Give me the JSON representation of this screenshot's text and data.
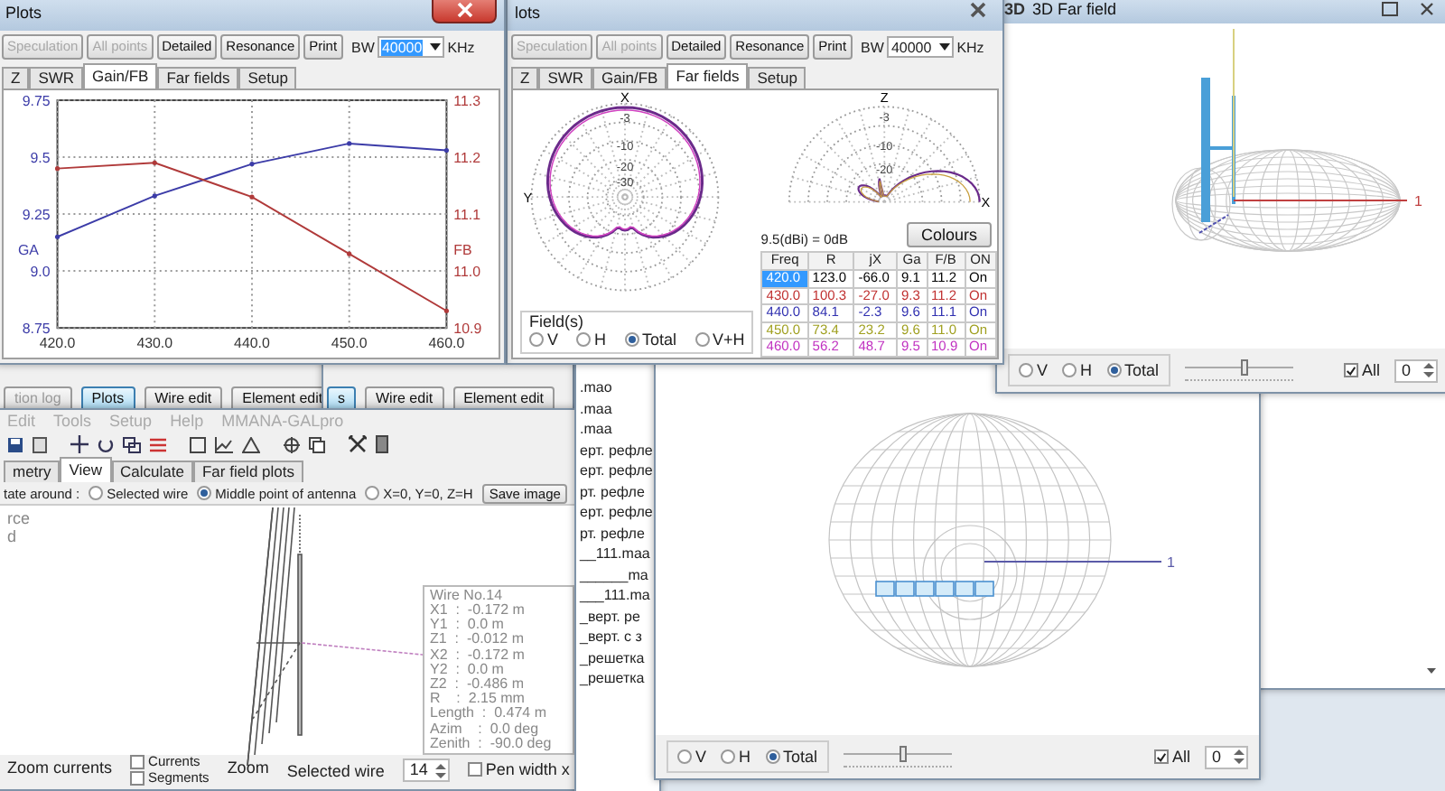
{
  "back_windows": [
    {
      "buttons": [
        {
          "label": "tion log",
          "selected": false
        },
        {
          "label": "Plots",
          "selected": true
        },
        {
          "label": "Wire edit",
          "selected": false
        },
        {
          "label": "Element edit",
          "selected": false
        }
      ]
    },
    {
      "buttons": [
        {
          "label": "s",
          "selected": true
        },
        {
          "label": "Wire edit",
          "selected": false
        },
        {
          "label": "Element edit",
          "selected": false
        }
      ]
    }
  ],
  "main_window": {
    "menu": [
      "Edit",
      "Tools",
      "Setup",
      "Help",
      "MMANA-GALpro"
    ],
    "tabs": [
      {
        "label": "metry",
        "selected": false
      },
      {
        "label": "View",
        "selected": true
      },
      {
        "label": "Calculate",
        "selected": false
      },
      {
        "label": "Far field plots",
        "selected": false
      }
    ],
    "rotate_label": "tate around :",
    "rotate_options": [
      {
        "label": "Selected wire",
        "selected": false
      },
      {
        "label": "Middle point of antenna",
        "selected": true
      },
      {
        "label": "X=0, Y=0, Z=H",
        "selected": false
      }
    ],
    "save_button": "Save image",
    "legend": [
      "rce",
      "d"
    ],
    "wire_info": [
      "Wire No.14",
      "X1  :  -0.172 m",
      "Y1  :  0.0 m",
      "Z1  :  -0.012 m",
      "X2  :  -0.172 m",
      "Y2  :  0.0 m",
      "Z2  :  -0.486 m",
      "R    :  2.15 mm",
      "Length  :  0.474 m",
      "Azim    :  0.0 deg",
      "Zenith  :  -90.0 deg"
    ],
    "zoom_currents": "Zoom currents",
    "checks": [
      {
        "label": "Currents",
        "checked": false
      },
      {
        "label": "Segments",
        "checked": false
      }
    ],
    "zoom_label": "Zoom",
    "selected_wire_label": "Selected wire",
    "selected_wire": "14",
    "pen_width": {
      "label": "Pen width x",
      "checked": false
    }
  },
  "file_list": {
    "items": [
      ".mao",
      ".maa",
      ".maa",
      "ерт. рефле",
      "ерт. рефле",
      "рт. рефле",
      "ерт. рефле",
      "рт. рефле",
      "__111.maa",
      "______ma",
      "___111.ma",
      "_верт. ре",
      "_верт. с з",
      "_решетка",
      "_решетка"
    ]
  },
  "plots_windows": [
    {
      "kind": "gain_fb",
      "title": "Plots",
      "close_active": true,
      "toolbar": [
        {
          "label": "Speculation",
          "disabled": true
        },
        {
          "label": "All points",
          "disabled": true
        },
        {
          "label": "Detailed",
          "disabled": false
        },
        {
          "label": "Resonance",
          "disabled": false
        },
        {
          "label": "Print",
          "disabled": false
        }
      ],
      "bw_label": "BW",
      "bw_value": "40000",
      "bw_highlighted": true,
      "unit": "KHz",
      "tabs": [
        {
          "label": "Z",
          "selected": false
        },
        {
          "label": "SWR",
          "selected": false
        },
        {
          "label": "Gain/FB",
          "selected": true
        },
        {
          "label": "Far fields",
          "selected": false
        },
        {
          "label": "Setup",
          "selected": false
        }
      ],
      "chart_data": {
        "type": "line",
        "grid": true,
        "x": [
          420,
          430,
          440,
          450,
          460
        ],
        "xlim": [
          420,
          460
        ],
        "xticks": [
          {
            "value": 420,
            "label": "420.0"
          },
          {
            "value": 430,
            "label": "430.0"
          },
          {
            "value": 440,
            "label": "440.0"
          },
          {
            "value": 450,
            "label": "450.0"
          },
          {
            "value": 460,
            "label": "460.0"
          }
        ],
        "ylim": [
          8.75,
          9.75
        ],
        "yticks": [
          {
            "value": 9.75,
            "label": "9.75"
          },
          {
            "value": 9.5,
            "label": "9.5"
          },
          {
            "value": 9.25,
            "label": "9.25"
          },
          {
            "value": 9.0,
            "label": "9.0"
          },
          {
            "value": 8.75,
            "label": "8.75"
          }
        ],
        "y2lim": [
          10.9,
          11.3
        ],
        "y2ticks": [
          {
            "value": 11.3,
            "label": "11.3"
          },
          {
            "value": 11.2,
            "label": "11.2"
          },
          {
            "value": 11.1,
            "label": "11.1"
          },
          {
            "value": 11.0,
            "label": "11.0"
          },
          {
            "value": 10.9,
            "label": "10.9"
          }
        ],
        "series": [
          {
            "name": "GA",
            "color": "#3c3ca8",
            "values": [
              9.15,
              9.33,
              9.47,
              9.56,
              9.53
            ]
          },
          {
            "name": "FB",
            "color": "#b03a3a",
            "axis": "y2",
            "values": [
              11.18,
              11.19,
              11.13,
              11.03,
              10.93
            ]
          }
        ]
      }
    },
    {
      "kind": "far_fields",
      "title": "lots",
      "close_active": false,
      "toolbar": [
        {
          "label": "Speculation",
          "disabled": true
        },
        {
          "label": "All points",
          "disabled": true
        },
        {
          "label": "Detailed",
          "disabled": false
        },
        {
          "label": "Resonance",
          "disabled": false
        },
        {
          "label": "Print",
          "disabled": false
        }
      ],
      "bw_label": "BW",
      "bw_value": "40000",
      "bw_highlighted": false,
      "unit": "KHz",
      "tabs": [
        {
          "label": "Z",
          "selected": false
        },
        {
          "label": "SWR",
          "selected": false
        },
        {
          "label": "Gain/FB",
          "selected": false
        },
        {
          "label": "Far fields",
          "selected": true
        },
        {
          "label": "Setup",
          "selected": false
        }
      ],
      "polar_left": {
        "top_label": "X",
        "side_label": "Y",
        "ring_labels": [
          "-3",
          "-10",
          "-20",
          "-30"
        ]
      },
      "polar_right": {
        "top_label": "Z",
        "side_label": "X",
        "ring_labels": [
          "-3",
          "-10",
          "-20"
        ]
      },
      "caption": "9.5(dBi) = 0dB",
      "colours_button": "Colours",
      "table": {
        "columns": [
          "Freq",
          "R",
          "jX",
          "Ga",
          "F/B",
          "ON"
        ],
        "rows": [
          {
            "cells": [
              "420.0",
              "123.0",
              "-66.0",
              "9.1",
              "11.2",
              "On"
            ],
            "color": "#000000",
            "selected": true
          },
          {
            "cells": [
              "430.0",
              "100.3",
              "-27.0",
              "9.3",
              "11.2",
              "On"
            ],
            "color": "#c03030",
            "selected": false
          },
          {
            "cells": [
              "440.0",
              "84.1",
              "-2.3",
              "9.6",
              "11.1",
              "On"
            ],
            "color": "#3030b0",
            "selected": false
          },
          {
            "cells": [
              "450.0",
              "73.4",
              "23.2",
              "9.6",
              "11.0",
              "On"
            ],
            "color": "#a0a020",
            "selected": false
          },
          {
            "cells": [
              "460.0",
              "56.2",
              "48.7",
              "9.5",
              "10.9",
              "On"
            ],
            "color": "#c030c0",
            "selected": false
          }
        ]
      },
      "fields_label": "Field(s)",
      "fields": [
        {
          "label": "V",
          "selected": false
        },
        {
          "label": "H",
          "selected": false
        },
        {
          "label": "Total",
          "selected": true
        },
        {
          "label": "V+H",
          "selected": false
        }
      ]
    }
  ],
  "far_field_windows": [
    {
      "title": "3D Far field",
      "icon_text": "3D",
      "kind": "side",
      "axis_label": "1",
      "fields": [
        {
          "label": "V",
          "selected": false
        },
        {
          "label": "H",
          "selected": false
        },
        {
          "label": "Total",
          "selected": true
        }
      ],
      "slider": {
        "level": 0.55
      },
      "all": {
        "label": "All",
        "checked": true
      },
      "spin": "0"
    },
    {
      "kind": "top",
      "axis_label": "1",
      "fields": [
        {
          "label": "V",
          "selected": false
        },
        {
          "label": "H",
          "selected": false
        },
        {
          "label": "Total",
          "selected": true
        }
      ],
      "slider": {
        "level": 0.55
      },
      "all": {
        "label": "All",
        "checked": true
      },
      "spin": "0"
    }
  ]
}
